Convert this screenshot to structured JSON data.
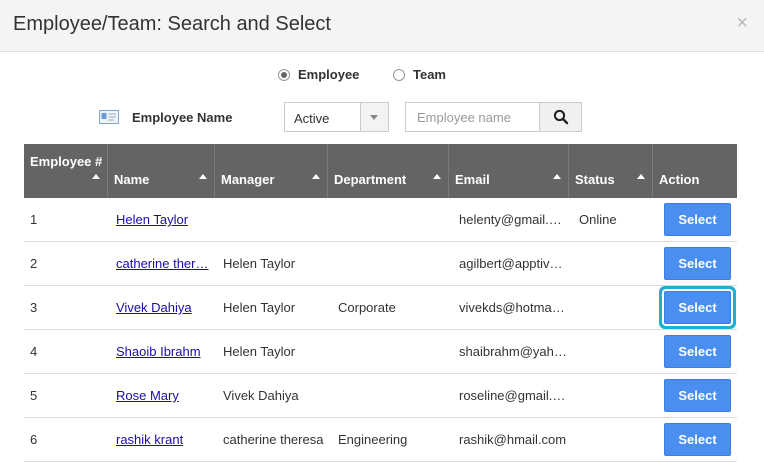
{
  "dialog": {
    "title": "Employee/Team: Search and Select",
    "close": "×"
  },
  "type_options": [
    {
      "label": "Employee",
      "checked": true
    },
    {
      "label": "Team",
      "checked": false
    }
  ],
  "filter": {
    "label": "Employee Name",
    "status_value": "Active",
    "search_placeholder": "Employee name"
  },
  "columns": [
    "Employee #",
    "Name",
    "Manager",
    "Department",
    "Email",
    "Status",
    "Action"
  ],
  "rows": [
    {
      "num": "1",
      "name": "Helen Taylor",
      "manager": "",
      "department": "",
      "email": "helenty@gmail.c…",
      "status": "Online",
      "action": "Select"
    },
    {
      "num": "2",
      "name": "catherine ther…",
      "manager": "Helen Taylor",
      "department": "",
      "email": "agilbert@apptivo…",
      "status": "",
      "action": "Select"
    },
    {
      "num": "3",
      "name": "Vivek Dahiya",
      "manager": "Helen Taylor",
      "department": "Corporate",
      "email": "vivekds@hotmai…",
      "status": "",
      "action": "Select"
    },
    {
      "num": "4",
      "name": "Shaoib Ibrahm",
      "manager": "Helen Taylor",
      "department": "",
      "email": "shaibrahm@yah…",
      "status": "",
      "action": "Select"
    },
    {
      "num": "5",
      "name": "Rose Mary",
      "manager": "Vivek Dahiya",
      "department": "",
      "email": "roseline@gmail.…",
      "status": "",
      "action": "Select"
    },
    {
      "num": "6",
      "name": "rashik krant",
      "manager": "catherine theresa",
      "department": "Engineering",
      "email": "rashik@hmail.com",
      "status": "",
      "action": "Select"
    }
  ]
}
